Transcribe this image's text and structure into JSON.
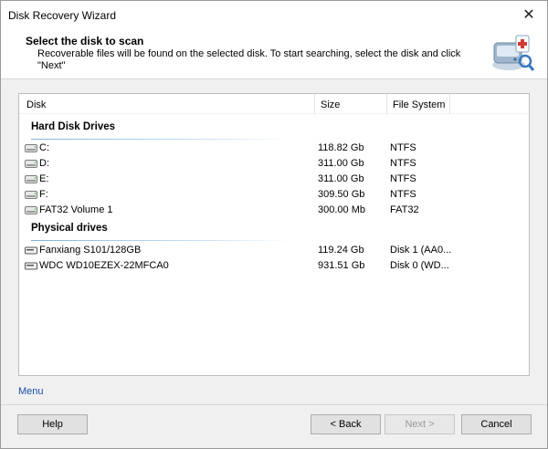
{
  "window": {
    "title": "Disk Recovery Wizard"
  },
  "header": {
    "title": "Select the disk to scan",
    "description": "Recoverable files will be found on the selected disk. To start searching, select the disk and click \"Next\""
  },
  "columns": {
    "disk": "Disk",
    "size": "Size",
    "file_system": "File System"
  },
  "groups": {
    "hard_disk_drives": {
      "label": "Hard Disk Drives",
      "items": [
        {
          "name": "C:",
          "size": "118.82 Gb",
          "fs": "NTFS"
        },
        {
          "name": "D:",
          "size": "311.00 Gb",
          "fs": "NTFS"
        },
        {
          "name": "E:",
          "size": "311.00 Gb",
          "fs": "NTFS"
        },
        {
          "name": "F:",
          "size": "309.50 Gb",
          "fs": "NTFS"
        },
        {
          "name": "FAT32 Volume 1",
          "size": "300.00 Mb",
          "fs": "FAT32"
        }
      ]
    },
    "physical_drives": {
      "label": "Physical drives",
      "items": [
        {
          "name": "Fanxiang S101/128GB",
          "size": "119.24 Gb",
          "fs": "Disk 1 (AA0..."
        },
        {
          "name": "WDC WD10EZEX-22MFCA0",
          "size": "931.51 Gb",
          "fs": "Disk 0 (WD..."
        }
      ]
    }
  },
  "footer": {
    "menu_label": "Menu",
    "help_label": "Help",
    "back_label": "< Back",
    "next_label": "Next >",
    "cancel_label": "Cancel"
  },
  "colors": {
    "link": "#1a4fa8",
    "group_underline": "#7fb3de"
  }
}
